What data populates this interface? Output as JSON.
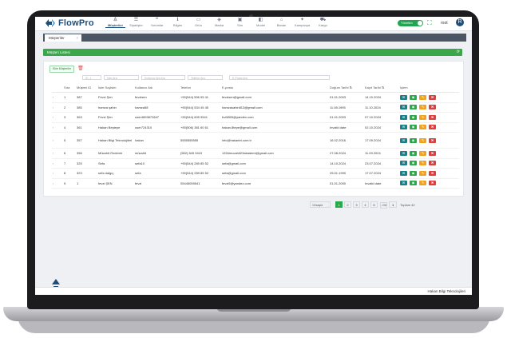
{
  "app": {
    "logo_text": "FlowPro",
    "brand_color": "#1f4e79",
    "accent_color": "#2aa84a"
  },
  "nav": [
    {
      "label": "Müşteriler",
      "icon": "user-icon",
      "glyph": "♙"
    },
    {
      "label": "Siparişler",
      "icon": "list-icon",
      "glyph": "☰"
    },
    {
      "label": "Yorumlar",
      "icon": "comment-icon",
      "glyph": "❝"
    },
    {
      "label": "Bilgim",
      "icon": "info-icon",
      "glyph": "ℹ"
    },
    {
      "label": "Ürün",
      "icon": "laptop-icon",
      "glyph": "▭"
    },
    {
      "label": "Marka",
      "icon": "tag-icon",
      "glyph": "◈"
    },
    {
      "label": "Sim",
      "icon": "chip-icon",
      "glyph": "▣"
    },
    {
      "label": "Model",
      "icon": "model-icon",
      "glyph": "◧"
    },
    {
      "label": "Banan",
      "icon": "store-icon",
      "glyph": "⌂"
    },
    {
      "label": "Kampanya",
      "icon": "megaphone-icon",
      "glyph": "✦"
    },
    {
      "label": "Kargo",
      "icon": "truck-icon",
      "glyph": "⛟"
    }
  ],
  "header": {
    "toggle_label": "Yönetim",
    "user_name": "root",
    "user_initial": "R"
  },
  "tab": {
    "label": "Müşteriler",
    "close": "×"
  },
  "panel": {
    "title": "Müşteri Listesi",
    "refresh_glyph": "⟳"
  },
  "toolbar": {
    "add_label": "Ekle Müşteriler",
    "delete_glyph": "🗑"
  },
  "filters": {
    "id": "ID_1",
    "name": "İsim Ara",
    "username": "Kullanıcı Adı Ara",
    "phone": "Telefon Ara",
    "email": "E-Posta Ara"
  },
  "columns": [
    "",
    "Sıra",
    "Müşteri ID",
    "İsim Soyisim",
    "Kullanıcı Adı",
    "Telefon",
    "E-posta",
    "Doğum Tarihi",
    "Kayıt Tarihi",
    "İşlem"
  ],
  "rows": [
    {
      "n": "1",
      "id": "387",
      "name": "Fevzi Şen",
      "user": "fevzisen",
      "phone": "+90(544) 506 95 41",
      "email": "fevzisen@gmail.com",
      "birth": "01.01.2003",
      "reg": "14.10.2024"
    },
    {
      "n": "2",
      "id": "385",
      "name": "hamza şahin",
      "user": "hamza58",
      "phone": "+90(544) 534 45 45",
      "email": "hamzasahin813@gmail.com",
      "birth": "11.08.1995",
      "reg": "11.10.2024"
    },
    {
      "n": "3",
      "id": "363",
      "name": "Fevzi Şen",
      "user": "user4893872847",
      "phone": "+90(544) 605 9541",
      "email": "fvz5855@yandex.com",
      "birth": "01.01.2003",
      "reg": "07.10.2024"
    },
    {
      "n": "4",
      "id": "361",
      "name": "Hakan Beştepe",
      "user": "user724310",
      "phone": "+90(506) 381 60 61",
      "email": "hakan.8tepe@gmail.com",
      "birth": "Invalid date",
      "reg": "02.10.2024"
    },
    {
      "n": "5",
      "id": "357",
      "name": "Hakan Bilgi Teknolojileri",
      "user": "hakan",
      "phone": "5555555555",
      "email": "info@hakanbt.com.tr",
      "birth": "16.02.2016",
      "reg": "17.09.2024"
    },
    {
      "n": "6",
      "id": "356",
      "name": "Mücahit Özdemir",
      "user": "mücahit",
      "phone": "(552) 849 9415",
      "email": "1334mucahit23akademi@gmail.com",
      "birth": "27.08.2024",
      "reg": "11.09.2024"
    },
    {
      "n": "7",
      "id": "325",
      "name": "Sefa",
      "user": "sefa10",
      "phone": "+90(544) 289 85 52",
      "email": "sefa@gmail.com",
      "birth": "14.10.2024",
      "reg": "23.07.2024"
    },
    {
      "n": "8",
      "id": "323",
      "name": "sefa dalgıç",
      "user": "sefa",
      "phone": "+90(544) 289 85 52",
      "email": "sefa@gmail.com",
      "birth": "25.01.1999",
      "reg": "17.07.2024"
    },
    {
      "n": "9",
      "id": "1",
      "name": "fevzi ŞEN",
      "user": "fevzi",
      "phone": "05445059541",
      "email": "fevzi5@yandex.com",
      "birth": "01.01.2000",
      "reg": "Invalid date"
    }
  ],
  "pager": {
    "page_size": "10/sayfa",
    "pages": [
      "1",
      "2",
      "3",
      "4",
      "5"
    ],
    "prev": "‹",
    "next": "›",
    "go_label": "Git",
    "go_value": "1",
    "total": "Toplam 42"
  },
  "footer": {
    "text": "Hakan Bilgi Teknolojileri"
  }
}
